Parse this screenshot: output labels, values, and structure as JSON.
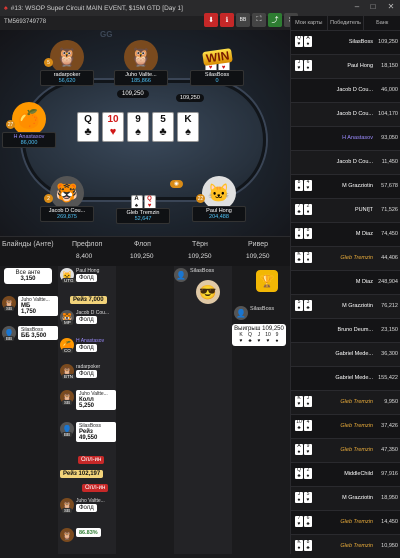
{
  "window": {
    "title": "#13: WSOP Super Circuit MAIN EVENT, $15M GTD [Day 1]",
    "hand_id": "TM5693749778",
    "buttons": [
      "↓",
      "ℹ",
      "BB",
      "⛶",
      "<",
      "✕"
    ]
  },
  "table": {
    "watermark": "GG",
    "pot": "109,250",
    "win_badge": "WIN",
    "board": [
      {
        "rank": "Q",
        "suit": "♣",
        "red": false
      },
      {
        "rank": "10",
        "suit": "♥",
        "red": true
      },
      {
        "rank": "9",
        "suit": "♠",
        "red": false
      },
      {
        "rank": "5",
        "suit": "♣",
        "red": false
      },
      {
        "rank": "K",
        "suit": "♠",
        "red": false
      }
    ],
    "players": [
      {
        "name": "radarpoker",
        "stack": "56,620",
        "seat": "5"
      },
      {
        "name": "Juho Vallte...",
        "stack": "185,866",
        "seat": ""
      },
      {
        "name": "SilasBoss",
        "stack": "0",
        "seat": ""
      },
      {
        "name": "H Anastasov",
        "stack": "86,000",
        "seat": "27"
      },
      {
        "name": "Jacob D Cou...",
        "stack": "269,875",
        "seat": "2"
      },
      {
        "name": "Glеb Тrеmzin",
        "stack": "52,647",
        "seat": ""
      },
      {
        "name": "Paul Hong",
        "stack": "204,488",
        "seat": "22"
      }
    ],
    "bet_left": "1,750",
    "bet_right": "109,250"
  },
  "streets": {
    "labels": [
      "Блайнды (Анте)",
      "Префлоп",
      "Флоп",
      "Тёрн",
      "Ривер"
    ],
    "values": [
      "",
      "8,400",
      "109,250",
      "109,250",
      "109,250"
    ]
  },
  "history": {
    "all_ante_label": "Все анте",
    "all_ante_value": "3,150",
    "actions": [
      {
        "name": "Juho Valtte...",
        "pos": "SB",
        "label": "МБ",
        "value": "1,750"
      },
      {
        "name": "SilasBoss",
        "pos": "BB",
        "label": "ББ 3,500",
        "value": ""
      },
      {
        "name": "Paul Hong",
        "pos": "UTG",
        "tag": "Фолд"
      },
      {
        "name": "Jacob D Cou...",
        "pos": "MP",
        "tag": "Фолд"
      },
      {
        "name": "H Anastasov",
        "pos": "CO",
        "tag": "Фолд"
      },
      {
        "name": "radarpoker",
        "pos": "BTN",
        "tag": "Фолд"
      },
      {
        "name": "Juho Valtte...",
        "pos": "SB",
        "label": "Колл",
        "value": "5,250"
      },
      {
        "name": "SilasBoss",
        "pos": "BB",
        "label": "Рейз",
        "value": "49,550",
        "tag": "Олл-ин"
      },
      {
        "name": "Juho Valtte...",
        "pos": "SB",
        "tag": "Фолд"
      }
    ],
    "raise1": "Рейз 7,000",
    "raise2": "Рейз 102,197",
    "allin_tag": "Олл-ин",
    "progress_label": "86.83%",
    "flop_player": "SilasBoss",
    "win_player": "SilasBoss",
    "win_text": "Выигрыш 109,250"
  },
  "results": {
    "headers": [
      "Мои карты",
      "Победитель",
      "Банк"
    ],
    "rows": [
      {
        "cards": [
          {
            "r": "Q",
            "s": "♥"
          },
          {
            "r": "A",
            "s": "♠"
          }
        ],
        "winner": "SilasBoss",
        "bank": "109,250",
        "style": ""
      },
      {
        "cards": [
          {
            "r": "J",
            "s": "♥"
          },
          {
            "r": "6",
            "s": "♠"
          }
        ],
        "winner": "Paul Hong",
        "bank": "18,150",
        "style": ""
      },
      {
        "cards": [],
        "winner": "Jacob D Cou...",
        "bank": "46,000",
        "style": ""
      },
      {
        "cards": [],
        "winner": "Jacob D Cou...",
        "bank": "104,170",
        "style": ""
      },
      {
        "cards": [],
        "winner": "H Anastasov",
        "bank": "93,050",
        "style": "purple"
      },
      {
        "cards": [],
        "winner": "Jacob D Cou...",
        "bank": "11,450",
        "style": ""
      },
      {
        "cards": [
          {
            "r": "8",
            "s": "♠"
          },
          {
            "r": "4",
            "s": "♥"
          }
        ],
        "winner": "M Grazziotin",
        "bank": "57,678",
        "style": ""
      },
      {
        "cards": [
          {
            "r": "7",
            "s": "♣"
          },
          {
            "r": "2",
            "s": "♦"
          }
        ],
        "winner": "PUNI]T",
        "bank": "71,526",
        "style": ""
      },
      {
        "cards": [
          {
            "r": "9",
            "s": "♠"
          },
          {
            "r": "8",
            "s": "♥"
          }
        ],
        "winner": "M Diaz",
        "bank": "74,450",
        "style": ""
      },
      {
        "cards": [
          {
            "r": "K",
            "s": "♣"
          },
          {
            "r": "3",
            "s": "♦"
          }
        ],
        "winner": "Gleb Tremzin",
        "bank": "44,406",
        "style": "gold"
      },
      {
        "cards": [],
        "winner": "M Diaz",
        "bank": "248,904",
        "style": ""
      },
      {
        "cards": [
          {
            "r": "5",
            "s": "♠"
          },
          {
            "r": "3",
            "s": "♣"
          }
        ],
        "winner": "M Grazziotin",
        "bank": "76,212",
        "style": ""
      },
      {
        "cards": [],
        "winner": "Bruno Deum...",
        "bank": "23,150",
        "style": ""
      },
      {
        "cards": [],
        "winner": "Gabriel Mede...",
        "bank": "36,300",
        "style": ""
      },
      {
        "cards": [],
        "winner": "Gabriel Mede...",
        "bank": "155,422",
        "style": ""
      },
      {
        "cards": [
          {
            "r": "K",
            "s": "♥"
          },
          {
            "r": "J",
            "s": "♠"
          }
        ],
        "winner": "Gleb Tremzin",
        "bank": "9,950",
        "style": "gold"
      },
      {
        "cards": [
          {
            "r": "10",
            "s": "♣"
          },
          {
            "r": "4",
            "s": "♠"
          }
        ],
        "winner": "Gleb Tremzin",
        "bank": "37,426",
        "style": "gold"
      },
      {
        "cards": [
          {
            "r": "A",
            "s": "♠"
          },
          {
            "r": "9",
            "s": "♥"
          }
        ],
        "winner": "Gleb Tremzin",
        "bank": "47,350",
        "style": "gold"
      },
      {
        "cards": [
          {
            "r": "Q",
            "s": "♣"
          },
          {
            "r": "2",
            "s": "♠"
          }
        ],
        "winner": "MiddleChild",
        "bank": "97,916",
        "style": ""
      },
      {
        "cards": [
          {
            "r": "J",
            "s": "♠"
          },
          {
            "r": "5",
            "s": "♥"
          }
        ],
        "winner": "M Grazziotin",
        "bank": "18,950",
        "style": ""
      },
      {
        "cards": [
          {
            "r": "7",
            "s": "♥"
          },
          {
            "r": "6",
            "s": "♣"
          }
        ],
        "winner": "Gleb Tremzin",
        "bank": "14,450",
        "style": "gold"
      },
      {
        "cards": [
          {
            "r": "K",
            "s": "♠"
          },
          {
            "r": "8",
            "s": "♣"
          }
        ],
        "winner": "Gleb Tremzin",
        "bank": "10,950",
        "style": "gold"
      }
    ]
  },
  "colors": {
    "accent_stack": "#4fc3f7",
    "gold": "#e5a93a",
    "purple": "#9c8cff"
  }
}
